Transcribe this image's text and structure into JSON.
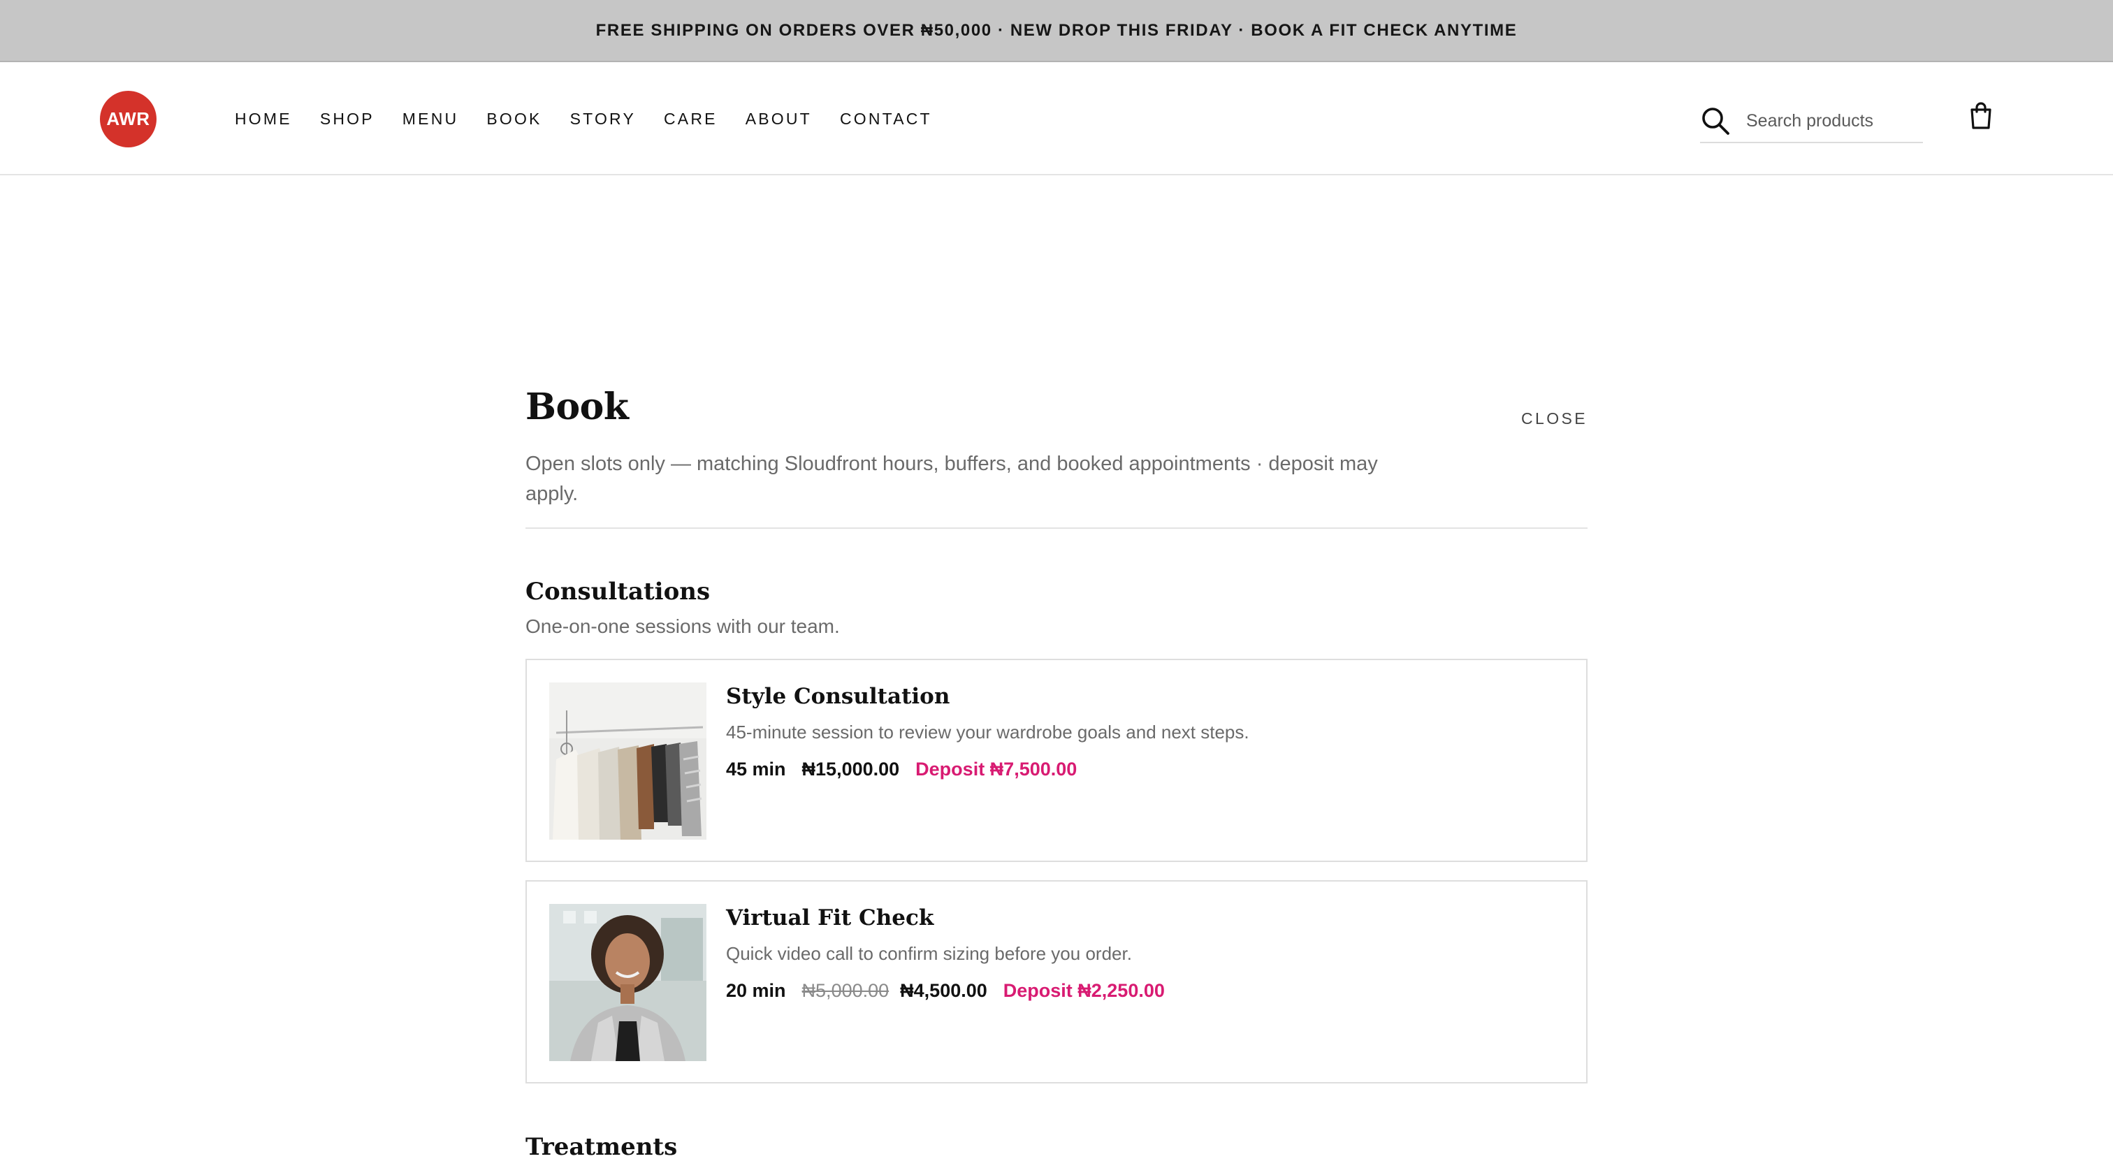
{
  "announcement": "FREE SHIPPING ON ORDERS OVER ₦50,000 · NEW DROP THIS FRIDAY · BOOK A FIT CHECK ANYTIME",
  "header": {
    "logo_text": "AWR",
    "nav": [
      "HOME",
      "SHOP",
      "MENU",
      "BOOK",
      "STORY",
      "CARE",
      "ABOUT",
      "CONTACT"
    ],
    "search_placeholder": "Search products",
    "icons": {
      "search": "search-icon",
      "cart": "shopping-bag-icon"
    }
  },
  "book": {
    "title": "Book",
    "close_label": "CLOSE",
    "subtitle": "Open slots only — matching Sloudfront hours, buffers, and booked appointments · deposit may apply.",
    "sections": [
      {
        "title": "Consultations",
        "subtitle": "One-on-one sessions with our team.",
        "services": [
          {
            "name": "Style Consultation",
            "description": "45-minute session to review your wardrobe goals and next steps.",
            "duration": "45 min",
            "original_price": "",
            "price": "₦15,000.00",
            "deposit": "Deposit ₦7,500.00",
            "image": "clothing-rack-photo"
          },
          {
            "name": "Virtual Fit Check",
            "description": "Quick video call to confirm sizing before you order.",
            "duration": "20 min",
            "original_price": "₦5,000.00",
            "price": "₦4,500.00",
            "deposit": "Deposit ₦2,250.00",
            "image": "stylist-portrait-photo"
          }
        ]
      },
      {
        "title": "Treatments"
      }
    ]
  },
  "colors": {
    "announcement_bg": "#c6c6c6",
    "logo_bg": "#d4322a",
    "deposit": "#d81b72",
    "muted_text": "#6a6a6a"
  }
}
